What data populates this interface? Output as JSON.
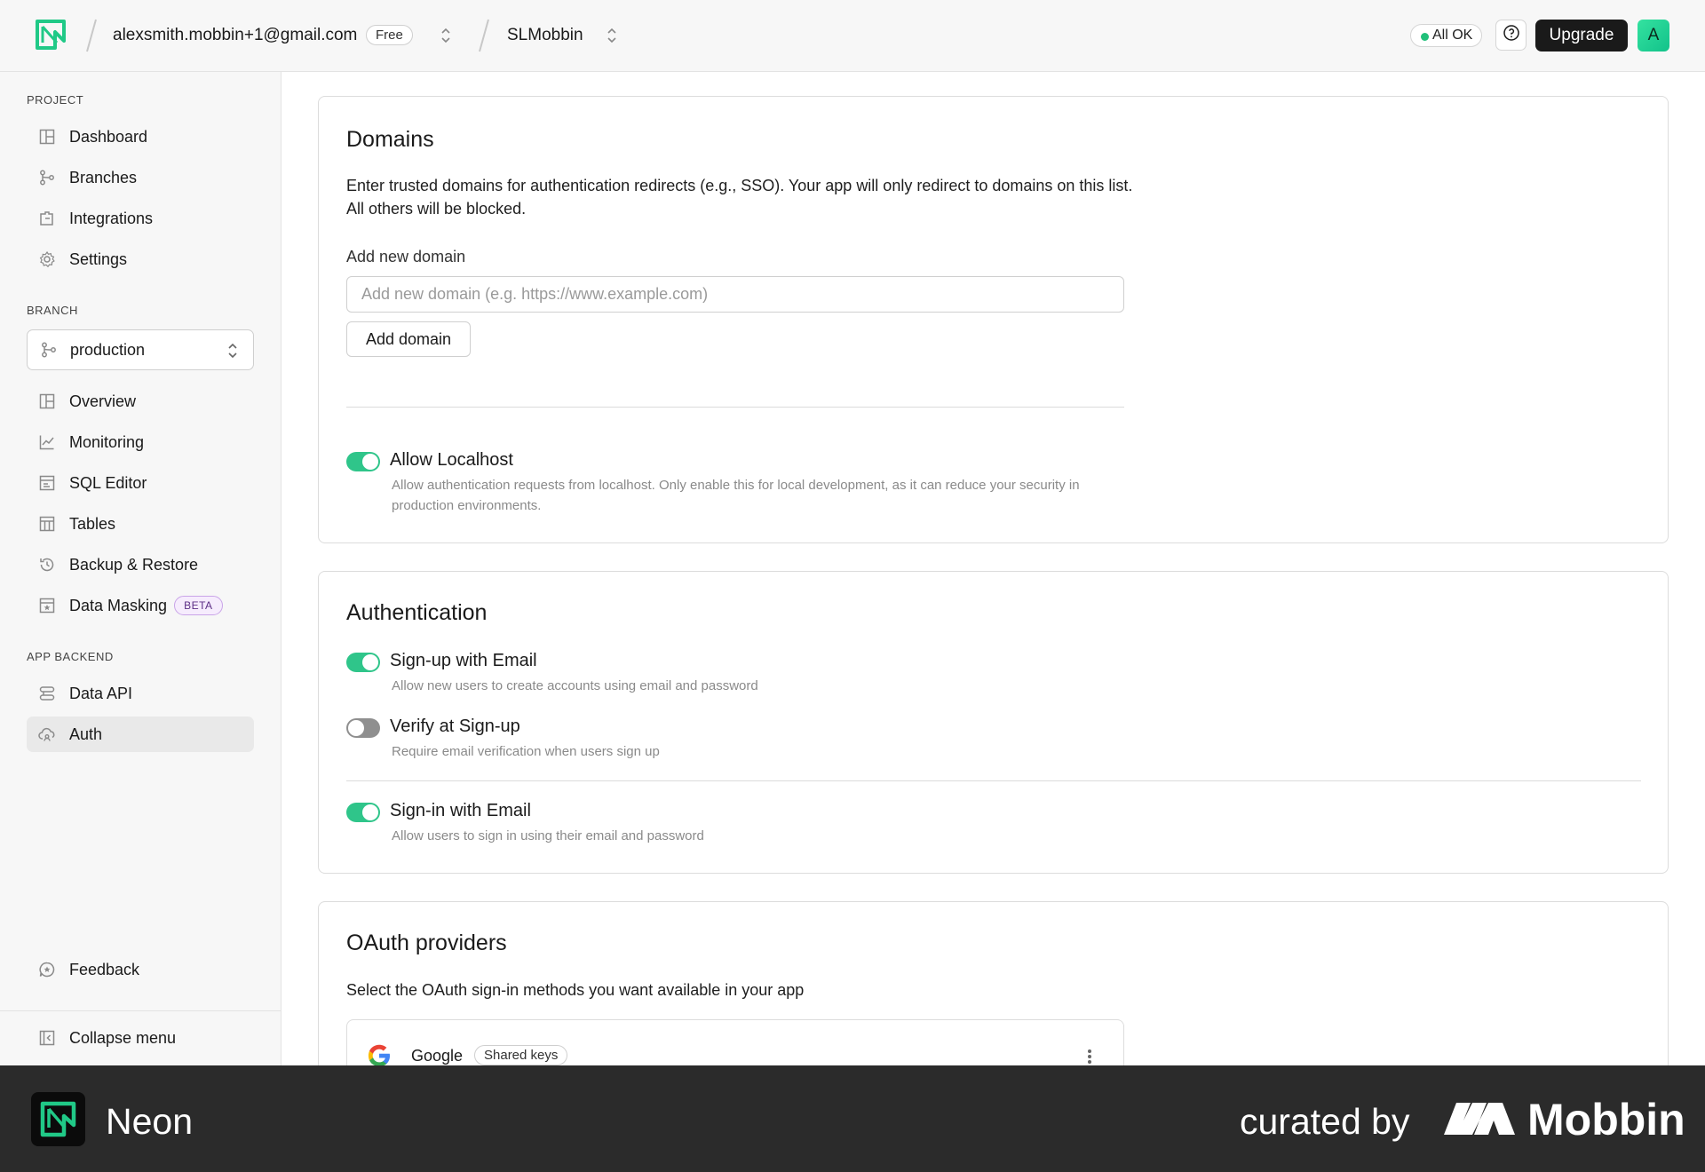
{
  "topbar": {
    "account_email": "alexsmith.mobbin+1@gmail.com",
    "plan_badge": "Free",
    "project_name": "SLMobbin",
    "status_label": "All OK",
    "upgrade_label": "Upgrade",
    "avatar_initial": "A",
    "status_color": "#21c07a"
  },
  "sidebar": {
    "project_section": "PROJECT",
    "project_items": [
      {
        "label": "Dashboard",
        "icon": "dashboard-icon"
      },
      {
        "label": "Branches",
        "icon": "branches-icon"
      },
      {
        "label": "Integrations",
        "icon": "integrations-icon"
      },
      {
        "label": "Settings",
        "icon": "gear-icon"
      }
    ],
    "branch_section": "BRANCH",
    "branch_selected": "production",
    "branch_items": [
      {
        "label": "Overview",
        "icon": "overview-icon"
      },
      {
        "label": "Monitoring",
        "icon": "chart-icon"
      },
      {
        "label": "SQL Editor",
        "icon": "sql-editor-icon"
      },
      {
        "label": "Tables",
        "icon": "table-icon"
      },
      {
        "label": "Backup & Restore",
        "icon": "history-icon"
      },
      {
        "label": "Data Masking",
        "icon": "mask-icon",
        "badge": "BETA"
      }
    ],
    "backend_section": "APP BACKEND",
    "backend_items": [
      {
        "label": "Data API",
        "icon": "api-icon"
      },
      {
        "label": "Auth",
        "icon": "auth-cloud-icon",
        "active": true
      }
    ],
    "feedback_label": "Feedback",
    "collapse_label": "Collapse menu"
  },
  "domains": {
    "title": "Domains",
    "description": "Enter trusted domains for authentication redirects (e.g., SSO). Your app will only redirect to domains on this list. All others will be blocked.",
    "field_label": "Add new domain",
    "input_placeholder": "Add new domain (e.g. https://www.example.com)",
    "input_value": "",
    "add_button": "Add domain",
    "localhost_title": "Allow Localhost",
    "localhost_desc": "Allow authentication requests from localhost. Only enable this for local development, as it can reduce your security in production environments.",
    "localhost_enabled": true
  },
  "authentication": {
    "title": "Authentication",
    "options": [
      {
        "title": "Sign-up with Email",
        "desc": "Allow new users to create accounts using email and password",
        "enabled": true
      },
      {
        "title": "Verify at Sign-up",
        "desc": "Require email verification when users sign up",
        "enabled": false
      },
      {
        "title": "Sign-in with Email",
        "desc": "Allow users to sign in using their email and password",
        "enabled": true
      }
    ]
  },
  "oauth": {
    "title": "OAuth providers",
    "description": "Select the OAuth sign-in methods you want available in your app",
    "providers": [
      {
        "name": "Google",
        "badge": "Shared keys",
        "icon": "google-icon"
      }
    ]
  },
  "footer": {
    "app_name": "Neon",
    "curated_by": "curated by",
    "brand": "Mobbin"
  },
  "colors": {
    "accent_green": "#2fc58a",
    "dark": "#1a1a1a",
    "footer_bg": "#2b2b2b"
  }
}
